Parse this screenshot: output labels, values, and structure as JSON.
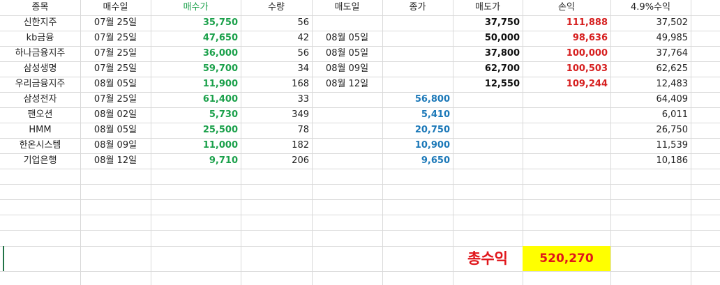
{
  "headers": [
    "종목",
    "매수일",
    "매수가",
    "수량",
    "매도일",
    "종가",
    "매도가",
    "손익",
    "4.9%수익"
  ],
  "rows": [
    {
      "name": "신한지주",
      "buy_date": "07월 25일",
      "buy_price": "35,750",
      "qty": "56",
      "sell_date": "",
      "close": "",
      "sell_price": "37,750",
      "profit": "111,888",
      "profit49": "37,502"
    },
    {
      "name": "kb금융",
      "buy_date": "07월 25일",
      "buy_price": "47,650",
      "qty": "42",
      "sell_date": "08월 05일",
      "close": "",
      "sell_price": "50,000",
      "profit": "98,636",
      "profit49": "49,985"
    },
    {
      "name": "하나금융지주",
      "buy_date": "07월 25일",
      "buy_price": "36,000",
      "qty": "56",
      "sell_date": "08월 05일",
      "close": "",
      "sell_price": "37,800",
      "profit": "100,000",
      "profit49": "37,764"
    },
    {
      "name": "삼성생명",
      "buy_date": "07월 25일",
      "buy_price": "59,700",
      "qty": "34",
      "sell_date": "08월 09일",
      "close": "",
      "sell_price": "62,700",
      "profit": "100,503",
      "profit49": "62,625"
    },
    {
      "name": "우리금융지주",
      "buy_date": "08월 05일",
      "buy_price": "11,900",
      "qty": "168",
      "sell_date": "08월 12일",
      "close": "",
      "sell_price": "12,550",
      "profit": "109,244",
      "profit49": "12,483"
    },
    {
      "name": "삼성전자",
      "buy_date": "07월 25일",
      "buy_price": "61,400",
      "qty": "33",
      "sell_date": "",
      "close": "56,800",
      "sell_price": "",
      "profit": "",
      "profit49": "64,409"
    },
    {
      "name": "팬오션",
      "buy_date": "08월 02일",
      "buy_price": "5,730",
      "qty": "349",
      "sell_date": "",
      "close": "5,410",
      "sell_price": "",
      "profit": "",
      "profit49": "6,011"
    },
    {
      "name": "HMM",
      "buy_date": "08월 05일",
      "buy_price": "25,500",
      "qty": "78",
      "sell_date": "",
      "close": "20,750",
      "sell_price": "",
      "profit": "",
      "profit49": "26,750"
    },
    {
      "name": "한온시스템",
      "buy_date": "08월 09일",
      "buy_price": "11,000",
      "qty": "182",
      "sell_date": "",
      "close": "10,900",
      "sell_price": "",
      "profit": "",
      "profit49": "11,539"
    },
    {
      "name": "기업은행",
      "buy_date": "08월 12일",
      "buy_price": "9,710",
      "qty": "206",
      "sell_date": "",
      "close": "9,650",
      "sell_price": "",
      "profit": "",
      "profit49": "10,186"
    }
  ],
  "total": {
    "label": "총수익",
    "value": "520,270"
  },
  "colors": {
    "buy_price": "#1aa04a",
    "close": "#1b78b8",
    "profit": "#d61f1f",
    "total_bg": "#ffff00",
    "total_text": "#e0161b",
    "grid": "#d9d9d9"
  }
}
